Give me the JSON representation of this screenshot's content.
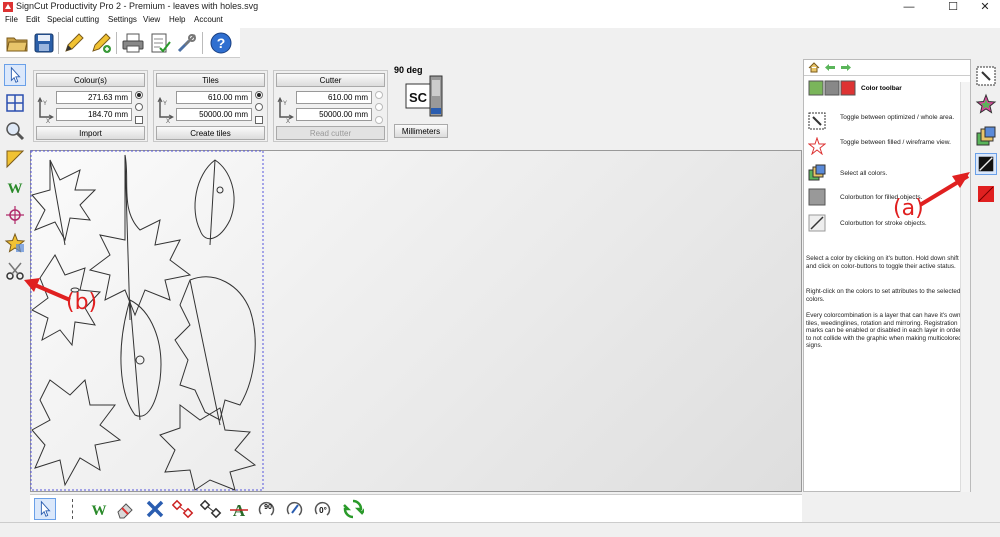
{
  "window": {
    "title": "SignCut Productivity Pro 2 - Premium - leaves with holes.svg",
    "minimize": "—",
    "maximize": "☐",
    "close": "✕"
  },
  "menu": [
    "File",
    "Edit",
    "Special cutting",
    "Settings",
    "View",
    "Help",
    "Account"
  ],
  "toolbar": {
    "icons": [
      "open-folder-icon",
      "save-icon",
      "pen-icon",
      "pen-add-icon",
      "print-icon",
      "checklist-icon",
      "tools-icon",
      "help-icon"
    ]
  },
  "left_tools": [
    "select-arrow-icon",
    "tiles-grid-icon",
    "zoom-icon",
    "ruler-icon",
    "weeding-icon",
    "registration-mark-icon",
    "star-shape-icon",
    "scissors-icon"
  ],
  "colours": {
    "title": "Colour(s)",
    "width": "271.63 mm",
    "height": "184.70 mm",
    "button": "Import"
  },
  "tiles": {
    "title": "Tiles",
    "width": "610.00 mm",
    "height": "50000.00 mm",
    "button": "Create tiles"
  },
  "cutter": {
    "title": "Cutter",
    "width": "610.00 mm",
    "height": "50000.00 mm",
    "button": "Read cutter"
  },
  "machine": {
    "rotation": "90 deg",
    "logo": "SC",
    "units_button": "Millimeters"
  },
  "bottom_tools": {
    "icons": [
      "select-arrow-icon",
      "weeding-icon",
      "eraser-icon",
      "close-x-icon",
      "nodes-icon",
      "nodes-outline-icon",
      "text-a-icon",
      "rotate-90-icon",
      "pen-rotate-icon",
      "rotate-0-icon",
      "recycle-icon"
    ],
    "rotate90_label": "90",
    "rotate0_label": "0°"
  },
  "right_panel": {
    "nav": [
      "home-icon",
      "back-arrow-icon",
      "forward-arrow-icon"
    ],
    "header": "Color toolbar",
    "items": [
      {
        "icon": "toggle-optimized-icon",
        "text": "Toggle between optimized / whole area."
      },
      {
        "icon": "toggle-filled-icon",
        "text": "Toggle between filled / wireframe view."
      },
      {
        "icon": "select-all-colors-icon",
        "text": "Select all colors."
      },
      {
        "icon": "colorbutton-filled-icon",
        "text": "Colorbutton for filled objects."
      },
      {
        "icon": "colorbutton-stroke-icon",
        "text": "Colorbutton for stroke objects."
      }
    ],
    "paragraphs": [
      "Select a color by clicking on it's button. Hold down shift and click on color-buttons to toggle their active status.",
      "Right-click on the colors to set attributes to the selected colors.",
      "Every colorcombination is a layer that can have it's own tiles, weedinglines, rotation and mirroring. Registration marks can be enabled or disabled in each layer in order to not collide with the graphic when making multicolored signs."
    ]
  },
  "right_strip": [
    "optimize-toggle-icon",
    "star-filled-icon",
    "select-all-colors-icon",
    "black-stroke-color-icon",
    "red-color-icon"
  ],
  "annotations": {
    "a": "(a)",
    "b": "(b)"
  },
  "colors": {
    "accent": "#3a7bd5",
    "annotation": "#e02020",
    "selection_dash": "#5555dd"
  }
}
